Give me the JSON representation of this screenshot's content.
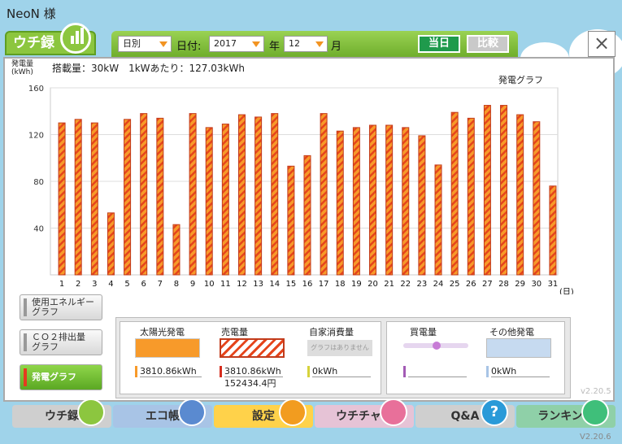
{
  "user": {
    "name": "NeoN 様"
  },
  "tab": {
    "label": "ウチ録"
  },
  "toolbar": {
    "period": "日別",
    "date_label": "日付:",
    "year_value": "2017",
    "year_unit": "年",
    "month_value": "12",
    "month_unit": "月",
    "today_label": "当日",
    "compare_label": "比較",
    "close_label": "×"
  },
  "info": {
    "ylabel_line1": "発電量",
    "ylabel_line2": "(kWh)",
    "capacity": "搭載量：30kW　1kWあたり：127.03kWh",
    "graph_title": "発電グラフ"
  },
  "chart_data": {
    "type": "bar",
    "ylabel": "発電量 (kWh)",
    "xlabel": "(日)",
    "ylim": [
      0,
      160
    ],
    "yticks": [
      40,
      80,
      120,
      160
    ],
    "categories": [
      "1",
      "2",
      "3",
      "4",
      "5",
      "6",
      "7",
      "8",
      "9",
      "10",
      "11",
      "12",
      "13",
      "14",
      "15",
      "16",
      "17",
      "18",
      "19",
      "20",
      "21",
      "22",
      "23",
      "24",
      "25",
      "26",
      "27",
      "28",
      "29",
      "30",
      "31"
    ],
    "values": [
      130,
      133,
      130,
      53,
      133,
      138,
      134,
      43,
      138,
      126,
      129,
      137,
      135,
      138,
      93,
      102,
      138,
      123,
      126,
      128,
      128,
      126,
      119,
      94,
      139,
      134,
      145,
      145,
      137,
      131,
      76
    ],
    "grid": true,
    "bar_color": "#f79a2a",
    "bar_stripe": "#e5451c"
  },
  "sidebar": {
    "items": [
      {
        "label1": "使用エネルギー",
        "label2": "グラフ"
      },
      {
        "label1": "ＣＯ２排出量",
        "label2": "グラフ"
      },
      {
        "label1": "発電グラフ",
        "label2": ""
      }
    ]
  },
  "legend": {
    "solar_title": "太陽光発電",
    "solar_value": "3810.86kWh",
    "sell_title": "売電量",
    "sell_value": "3810.86kWh",
    "sell_yen": "152434.4円",
    "self_title": "自家消費量",
    "self_note": "グラフはありません",
    "self_value": "0kWh",
    "buy_title": "買電量",
    "buy_value": "",
    "other_title": "その他発電",
    "other_value": "0kWh"
  },
  "nav": {
    "items": [
      {
        "label": "ウチ録",
        "color": "#c9c9c9",
        "icon": "bar-chart-icon"
      },
      {
        "label": "エコ帳",
        "color": "#a8c4e6",
        "icon": "notebook-icon"
      },
      {
        "label": "設定",
        "color": "#ffd24a",
        "icon": "wrench-icon"
      },
      {
        "label": "ウチチャレ",
        "color": "#e6c3d6",
        "icon": "flag-icon"
      },
      {
        "label": "Q&A",
        "color": "#c9c9c9",
        "icon": "question-icon"
      },
      {
        "label": "ランキング",
        "color": "#8fd0a8",
        "icon": "crown-icon"
      }
    ]
  },
  "version": {
    "inner": "v2.20.5",
    "outer": "V2.20.6"
  }
}
